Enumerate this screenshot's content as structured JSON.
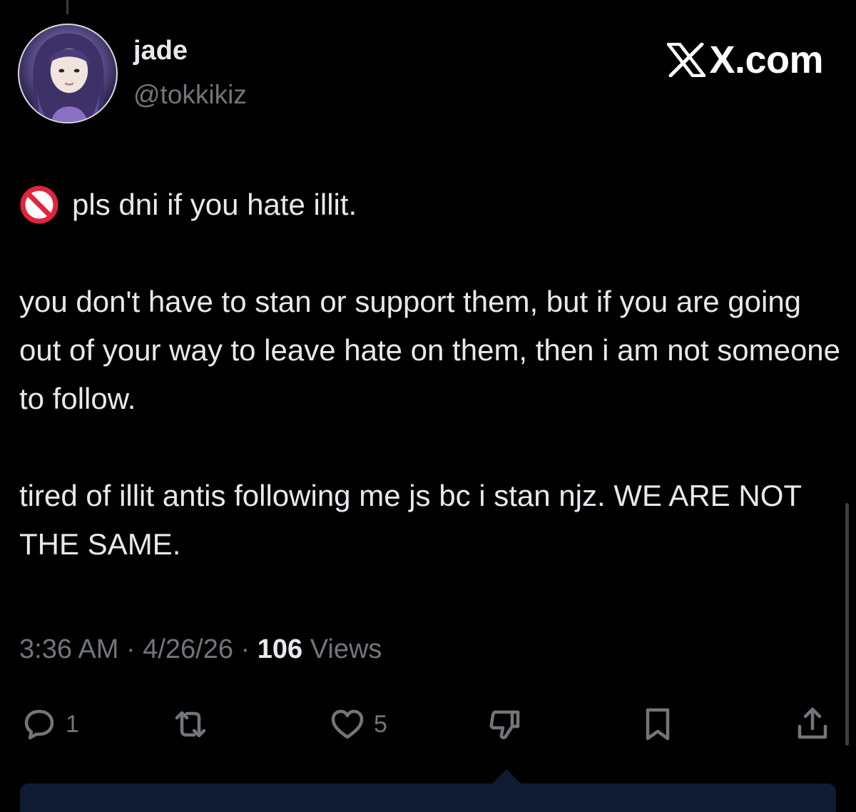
{
  "author": {
    "display_name": "jade",
    "handle": "@tokkikiz"
  },
  "brand": {
    "label": "X.com",
    "icon": "x-logo-icon"
  },
  "tweet": {
    "emoji_icon": "prohibited-icon",
    "line1": "pls dni if you hate illit.",
    "paragraph2": "you don't have to stan or support them, but if you are going out of your way to leave hate on them, then i am not someone to follow.",
    "paragraph3": "tired of illit antis following me js bc i stan njz. WE ARE NOT THE SAME."
  },
  "meta": {
    "time": "3:36 AM",
    "separator": " · ",
    "date": "4/26/26",
    "views_count": "106",
    "views_label": " Views"
  },
  "actions": {
    "reply_count": "1",
    "like_count": "5"
  },
  "colors": {
    "background": "#000000",
    "text_primary": "#e7e9ea",
    "text_secondary": "#71767b",
    "prohibited_red": "#e0253d"
  }
}
